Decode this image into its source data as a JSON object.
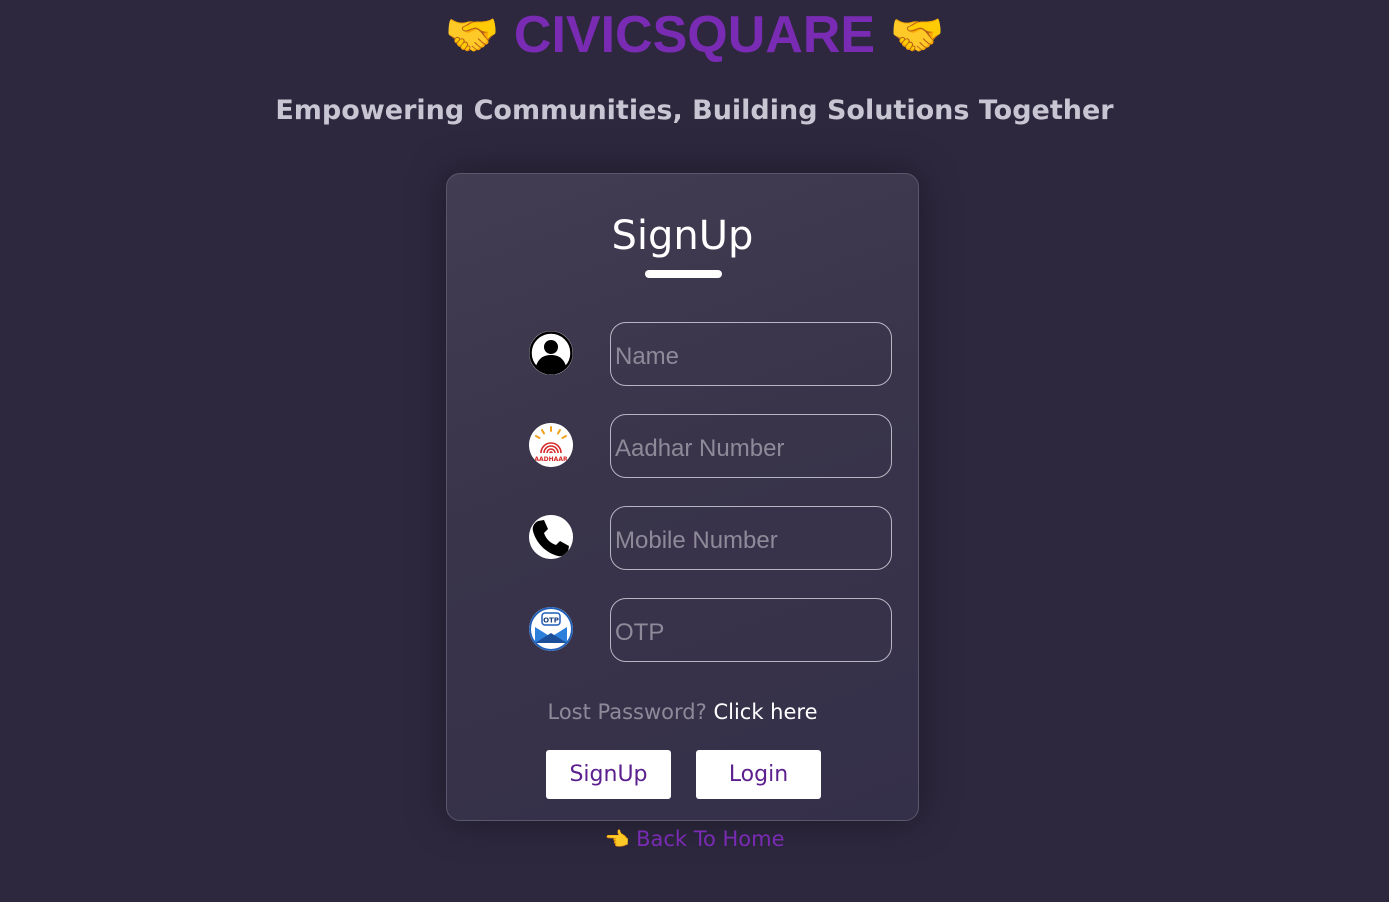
{
  "header": {
    "brand_name": "CIVICSQUARE",
    "brand_emoji": "🤝",
    "tagline": "Empowering Communities, Building Solutions Together"
  },
  "form": {
    "title": "SignUp",
    "fields": [
      {
        "icon": "user-icon",
        "placeholder": "Name",
        "value": ""
      },
      {
        "icon": "aadhaar-icon",
        "placeholder": "Aadhar Number",
        "value": ""
      },
      {
        "icon": "phone-icon",
        "placeholder": "Mobile Number",
        "value": ""
      },
      {
        "icon": "otp-mail-icon",
        "placeholder": "OTP",
        "value": ""
      }
    ],
    "aadhaar_logo_text": "AADHAAR",
    "otp_logo_text": "OTP",
    "lost_password_text": "Lost Password?",
    "click_here_text": "Click here",
    "signup_button": "SignUp",
    "login_button": "Login"
  },
  "footer": {
    "back_hand_emoji": "👈",
    "back_to_home": "Back To Home"
  },
  "colors": {
    "background": "#2d283e",
    "brand": "#7a2bb4",
    "button_text": "#5b1f8e"
  }
}
